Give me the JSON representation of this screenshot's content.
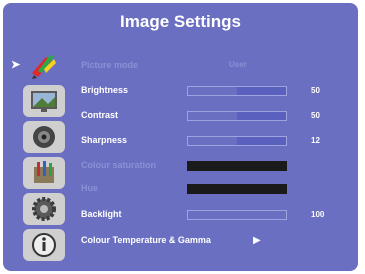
{
  "title": "Image Settings",
  "sidebar": {
    "items": [
      {
        "icon": "brush-palette-icon",
        "active": true
      },
      {
        "icon": "display-image-icon",
        "active": false
      },
      {
        "icon": "audio-speaker-icon",
        "active": false
      },
      {
        "icon": "tools-icon",
        "active": false
      },
      {
        "icon": "gear-icon",
        "active": false
      },
      {
        "icon": "info-icon",
        "active": false
      }
    ]
  },
  "settings": {
    "rows": [
      {
        "label": "Picture mode",
        "value_text": "User",
        "disabled": true
      },
      {
        "label": "Brightness",
        "value": 50,
        "max": 100,
        "value_label": "50"
      },
      {
        "label": "Contrast",
        "value": 50,
        "max": 100,
        "value_label": "50"
      },
      {
        "label": "Sharpness",
        "value": 12,
        "max": 24,
        "value_label": "12"
      },
      {
        "label": "Colour saturation",
        "disabled": true
      },
      {
        "label": "Hue",
        "disabled": true
      },
      {
        "label": "Backlight",
        "value": 100,
        "max": 100,
        "value_label": "100"
      },
      {
        "label": "Colour Temperature & Gamma",
        "submenu": true
      }
    ]
  },
  "colors": {
    "panel": "#6a6fc2",
    "text": "#ffffff",
    "disabled_text": "#8c91d4"
  }
}
